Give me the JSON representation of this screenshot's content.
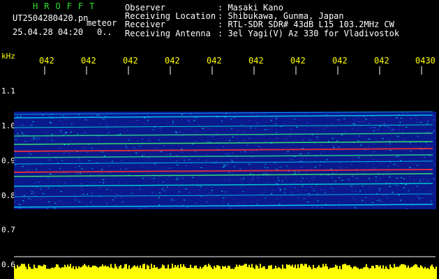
{
  "header": {
    "app_title": "HROFFT",
    "file_name": "UT2504280420.pn",
    "mode": "meteor",
    "timestamp": "25.04.28 04:20",
    "time_value": "0.."
  },
  "info": {
    "rows": [
      {
        "label": "Observer",
        "value": ": Masaki Kano"
      },
      {
        "label": "Receiving Location",
        "value": ": Shibukawa, Gunma, Japan"
      },
      {
        "label": "Receiver",
        "value": ": RTL-SDR SDR# 43dB L15 103.2MHz CW"
      },
      {
        "label": "Receiving Antenna",
        "value": ": 3el Yagi(V) Az 330 for Vladivostok"
      }
    ]
  },
  "axis": {
    "unit": "kHz",
    "y_ticks": [
      "1.1",
      "1.0",
      "0.9",
      "0.8",
      "0.7",
      "0.6"
    ],
    "x_ticks": [
      "042",
      "042",
      "042",
      "042",
      "042",
      "042",
      "042",
      "042",
      "042",
      "0430"
    ]
  },
  "colors": {
    "background": "#000000",
    "title": "#2ee22e",
    "axis_text": "#ffff00",
    "spectrum_base": "#0a1a8c",
    "echo_hot": "#ff2020",
    "audio_level": "#ffff00"
  }
}
